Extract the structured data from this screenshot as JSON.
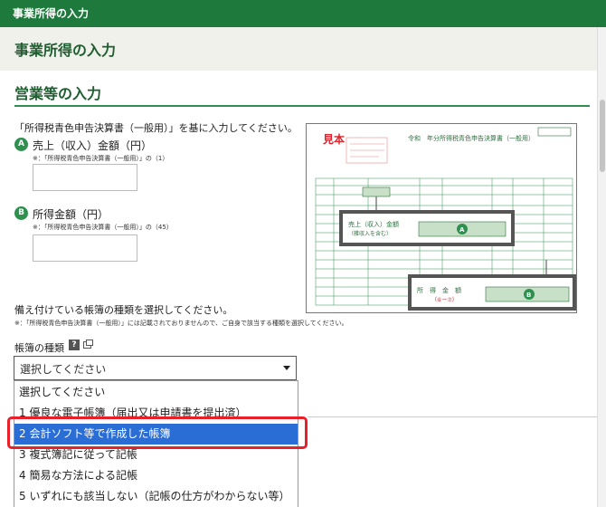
{
  "topbar": {
    "title": "事業所得の入力"
  },
  "page": {
    "title": "事業所得の入力"
  },
  "section": {
    "title": "営業等の入力"
  },
  "instruction": "「所得税青色申告決算書（一般用）」を基に入力してください。",
  "fields": [
    {
      "badge": "A",
      "label": "売上（収入）金額（円）",
      "note": "※：「所得税青色申告決算書（一般用）」の（1）",
      "value": ""
    },
    {
      "badge": "B",
      "label": "所得金額（円）",
      "note": "※：「所得税青色申告決算書（一般用）」の（45）",
      "value": ""
    }
  ],
  "doc_image": {
    "sample_stamp": "見本",
    "header": "令和　年分所得税青色申告決算書（一般用）",
    "callout_a_label": "売上（収入）金額",
    "callout_a_sub": "（雑収入を含む）",
    "callout_b_label": "所　得　金　額",
    "callout_b_sub": "（⑥ー⑦）",
    "badge_a": "A",
    "badge_b": "B"
  },
  "bookkeeping": {
    "question": "備え付けている帳簿の種類を選択してください。",
    "note": "※：「所得税青色申告決算書（一般用）」には記載されておりませんので、ご自身で該当する種類を選択してください。",
    "select_label": "帳簿の種類",
    "help_icon": "?",
    "selected_value": "選択してください",
    "options": [
      "選択してください",
      "1 優良な電子帳簿（届出又は申請書を提出済）",
      "2 会計ソフト等で作成した帳簿",
      "3 複式簿記に従って記帳",
      "4 簡易な方法による記帳",
      "5 いずれにも該当しない（記帳の仕方がわからない等）"
    ],
    "highlighted_index": 2
  },
  "colors": {
    "brand_green": "#1e7a3c",
    "title_green": "#1e5e30",
    "highlight_red": "#e8202a",
    "selection_blue": "#2a6dd4"
  }
}
